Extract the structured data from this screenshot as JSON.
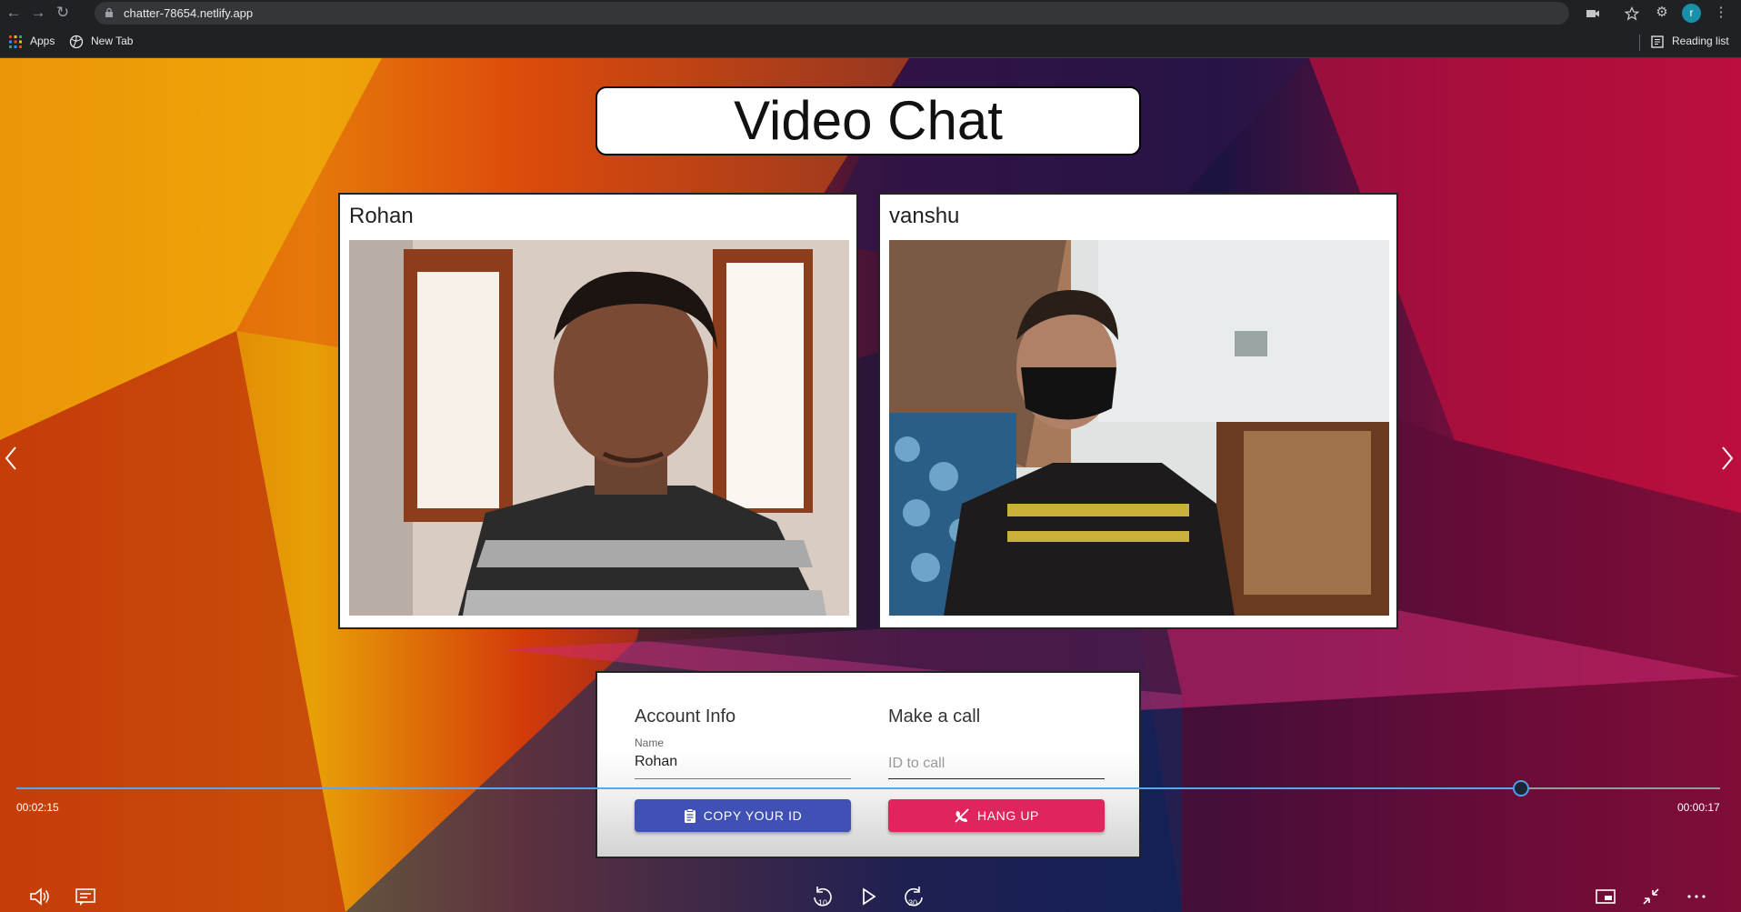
{
  "browser": {
    "url": "chatter-78654.netlify.app",
    "avatar_letter": "r",
    "bookmarks": [
      "Apps",
      "New Tab"
    ],
    "reading_list": "Reading list"
  },
  "app": {
    "title": "Video Chat",
    "videos": [
      {
        "name": "Rohan"
      },
      {
        "name": "vanshu"
      }
    ],
    "account": {
      "heading": "Account Info",
      "name_label": "Name",
      "name_value": "Rohan",
      "copy_button": "COPY YOUR ID"
    },
    "call": {
      "heading": "Make a call",
      "id_placeholder": "ID to call",
      "hangup_button": "HANG UP"
    }
  },
  "player": {
    "elapsed": "00:02:15",
    "remaining": "00:00:17",
    "progress_fraction": 0.884,
    "skip_back": "10",
    "skip_forward": "30"
  },
  "colors": {
    "copy_button": "#3f51b5",
    "hangup_button": "#e0245e",
    "seek_accent": "#5aa6e8"
  }
}
